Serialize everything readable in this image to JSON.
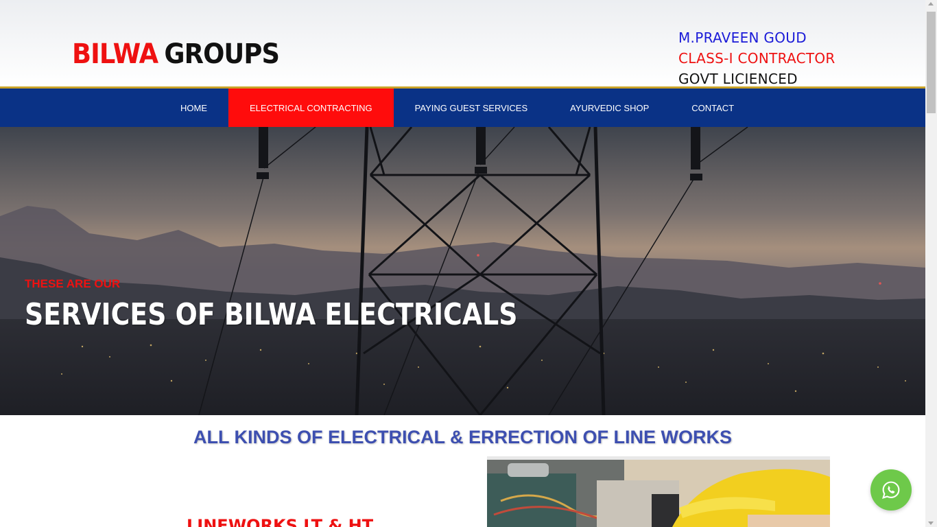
{
  "header": {
    "logo_part1": "BILWA",
    "logo_part2": "GROUPS",
    "contact_name": "M.PRAVEEN GOUD",
    "contact_class": "CLASS-I CONTRACTOR",
    "contact_license": "GOVT LICIENCED"
  },
  "nav": {
    "items": [
      {
        "label": "HOME"
      },
      {
        "label": "ELECTRICAL CONTRACTING"
      },
      {
        "label": "PAYING GUEST SERVICES"
      },
      {
        "label": "AYURVEDIC SHOP"
      },
      {
        "label": "CONTACT"
      }
    ],
    "active": "ELECTRICAL CONTRACTING"
  },
  "hero": {
    "subtitle": "THESE ARE OUR",
    "title": "SERVICES OF BILWA ELECTRICALS"
  },
  "content": {
    "section_title": "ALL KINDS OF ELECTRICAL & ERRECTION OF LINE WORKS",
    "sub_heading": "LINEWORKS LT & HT"
  },
  "colors": {
    "brand_red": "#ee1111",
    "nav_blue": "#0a3286",
    "nav_active": "#ff0c0c",
    "accent_gold": "#c9a227",
    "section_blue": "#3d4fb0",
    "whatsapp_green": "#6ec94a"
  },
  "icons": {
    "whatsapp": "whatsapp-icon"
  }
}
